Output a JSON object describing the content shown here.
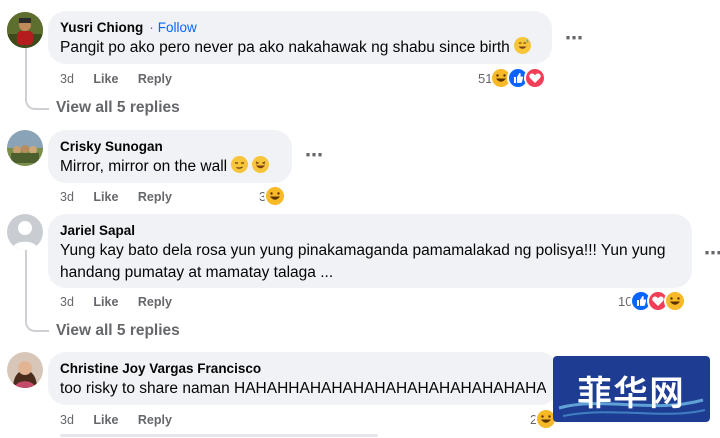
{
  "comments": [
    {
      "author": "Yusri Chiong",
      "follow_label": "Follow",
      "separator": "·",
      "text": "Pangit po ako pero never pa ako nakahawak ng shabu since birth",
      "time": "3d",
      "like_label": "Like",
      "reply_label": "Reply",
      "reaction_count": "51",
      "reactions": [
        "haha",
        "like",
        "love"
      ],
      "view_replies": "View all 5 replies"
    },
    {
      "author": "Crisky Sunogan",
      "text": "Mirror, mirror on the wall",
      "time": "3d",
      "like_label": "Like",
      "reply_label": "Reply",
      "reaction_count": "3",
      "reactions": [
        "haha"
      ]
    },
    {
      "author": "Jariel Sapal",
      "text_line1": "Yung kay bato dela rosa yun yung pinakamaganda pamamalakad ng polisya!!! Yun yung",
      "text_line2": "handang pumatay at mamatay talaga ...",
      "time": "3d",
      "like_label": "Like",
      "reply_label": "Reply",
      "reaction_count": "10",
      "reactions": [
        "like",
        "love",
        "haha"
      ],
      "view_replies": "View all 5 replies"
    },
    {
      "author": "Christine Joy Vargas Francisco",
      "text": "too risky to share naman HAHAHHAHAHAHAHAHAHAHAHAHAHAHAHA",
      "time": "3d",
      "like_label": "Like",
      "reply_label": "Reply",
      "reaction_count": "2",
      "reactions": [
        "haha"
      ]
    }
  ],
  "more_icon": "⋯",
  "watermark": {
    "text": "菲华网"
  },
  "colors": {
    "bubble": "#f0f2f5",
    "like": "#0866ff",
    "love": "#f33e58",
    "haha": "#f7b928"
  }
}
